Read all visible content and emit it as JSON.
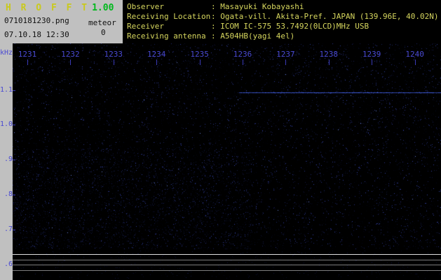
{
  "app": {
    "name": "HROFFT",
    "title_display": "H R O F F T",
    "version": "1.00",
    "filename": "0710181230.png",
    "mode_label": "meteor",
    "meteor_count": "0",
    "timestamp": "07.10.18 12:30"
  },
  "station_info": {
    "rows": [
      {
        "label": "Observer",
        "value": ": Masayuki Kobayashi"
      },
      {
        "label": "Receiving Location",
        "value": ": Ogata-vill. Akita-Pref. JAPAN (139.96E, 40.02N)"
      },
      {
        "label": "Receiver",
        "value": ": ICOM IC-575 53.7492(0LCD)MHz USB"
      },
      {
        "label": "Receiving antenna",
        "value": ": A504HB(yagi 4el)"
      }
    ]
  },
  "spectrogram": {
    "freq_axis_labels": [
      "kHz",
      "1.1",
      "1.0",
      ".9",
      ".8",
      ".7",
      ".6"
    ],
    "time_axis_labels": [
      "1231",
      "1232",
      "1233",
      "1234",
      "1235",
      "1236",
      "1237",
      "1238",
      "1239",
      "1240"
    ],
    "carrier_signal": {
      "frequency_khz": 1.09,
      "visible_from_time": "1236",
      "visible_to_time": "1240",
      "color": "#4a6aff"
    },
    "noise_color": "#2233bb",
    "background": "#000000"
  },
  "colors": {
    "window_bg": "#c0c0c0",
    "panel_bg": "#000000",
    "title_yellow": "#c9c91c",
    "version_green": "#00b81c",
    "station_text": "#d6d65e",
    "axis_blue": "#4949d2",
    "level_trace": "#dedede",
    "level_grid": "#7d7d7d"
  }
}
